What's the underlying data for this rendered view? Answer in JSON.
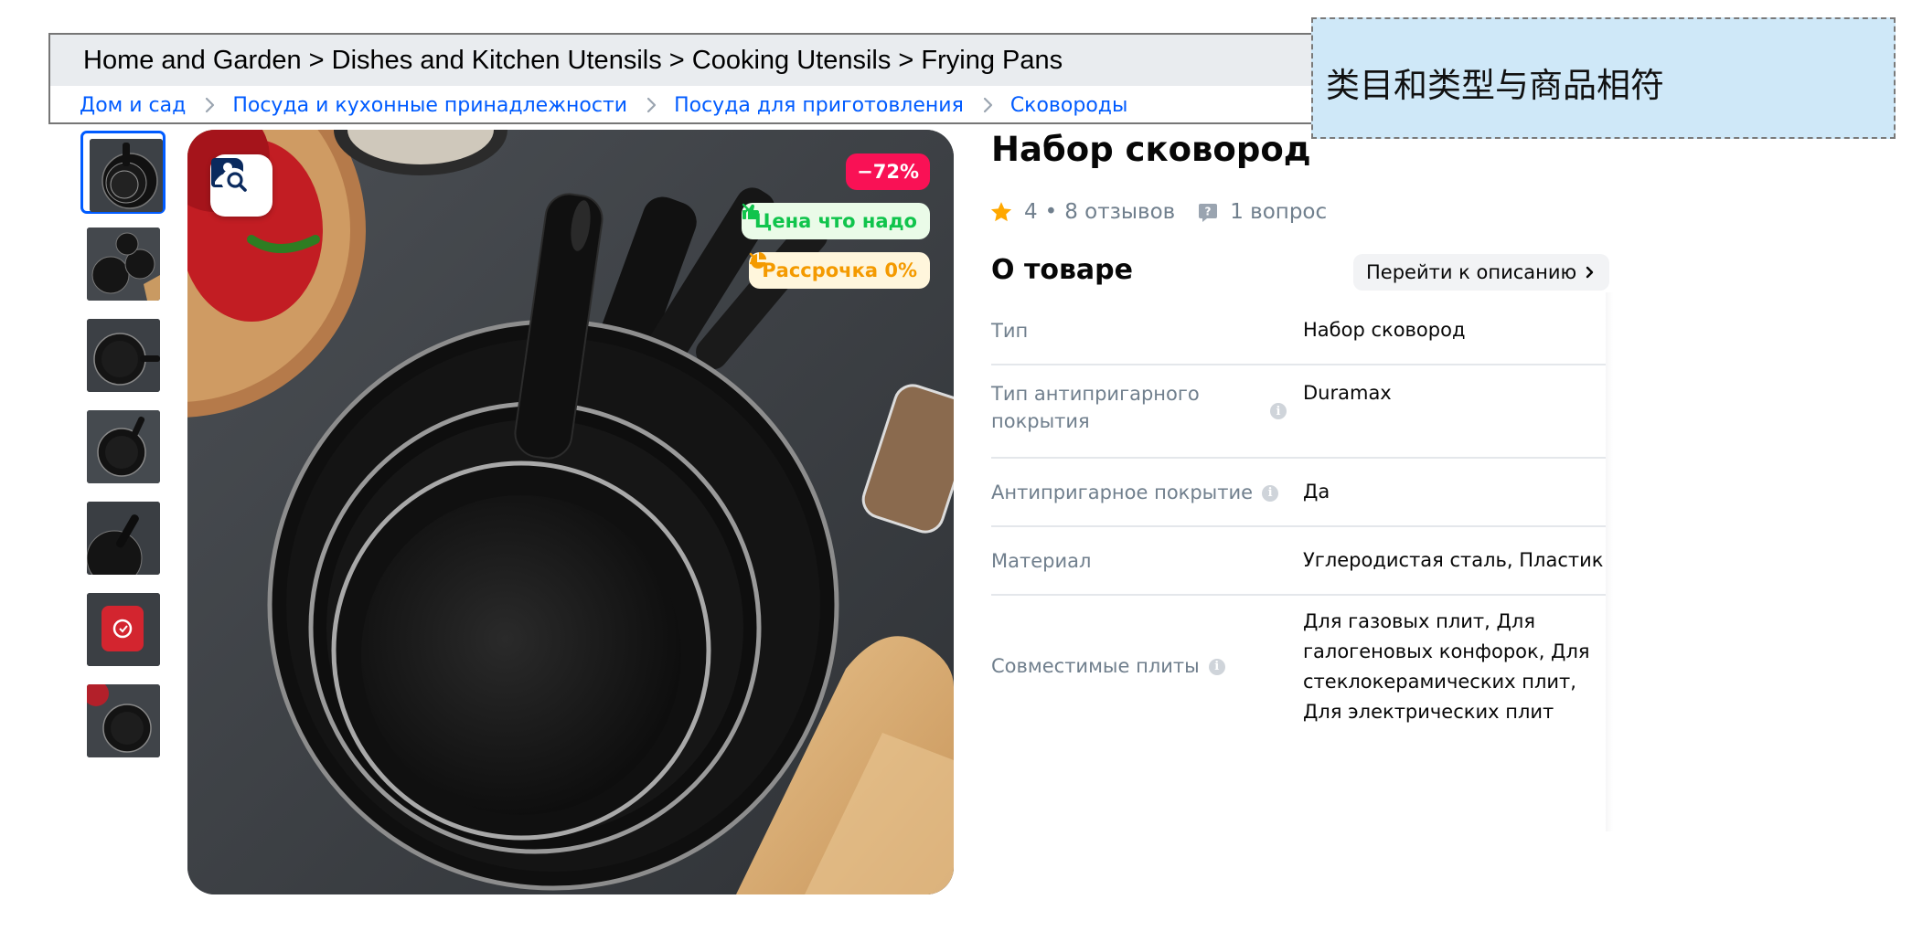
{
  "breadcrumb_en": {
    "text": "Home and Garden > Dishes and Kitchen Utensils > Cooking Utensils > Frying Pans"
  },
  "breadcrumb_ru": {
    "items": [
      "Дом и сад",
      "Посуда и кухонные принадлежности",
      "Посуда для приготовления",
      "Сковороды"
    ]
  },
  "annotation": {
    "text": "类目和类型与商品相符"
  },
  "gallery": {
    "thumbnail_count": 7,
    "active_index": 0,
    "discount_badge": "−72%",
    "promo_price": "Цена что надо",
    "promo_installment": "Рассрочка 0%"
  },
  "product": {
    "title": "Набор сковород",
    "rating": "4",
    "rating_separator": "•",
    "reviews": "8 отзывов",
    "questions": "1 вопрос"
  },
  "about": {
    "title": "О товаре",
    "goto_description": "Перейти к описанию",
    "properties": [
      {
        "name": "Тип",
        "value": "Набор сковород",
        "info": false
      },
      {
        "name": "Тип антипригарного покрытия",
        "value": "Duramax",
        "info": true
      },
      {
        "name": "Антипригарное покрытие",
        "value": "Да",
        "info": true
      },
      {
        "name": "Материал",
        "value": "Углеродистая сталь, Пластик",
        "info": false
      },
      {
        "name": "Совместимые плиты",
        "value": "Для газовых плит, Для галогеновых конфорок, Для стеклокерамических плит, Для электрических плит",
        "info": true
      }
    ]
  },
  "colors": {
    "link": "#005bff",
    "discount": "#f91155",
    "promo_green": "#10c44c",
    "promo_orange": "#f49a00",
    "star": "#ffa800",
    "muted_text": "#707f8d",
    "annotation_bg": "#cfe8f8"
  }
}
